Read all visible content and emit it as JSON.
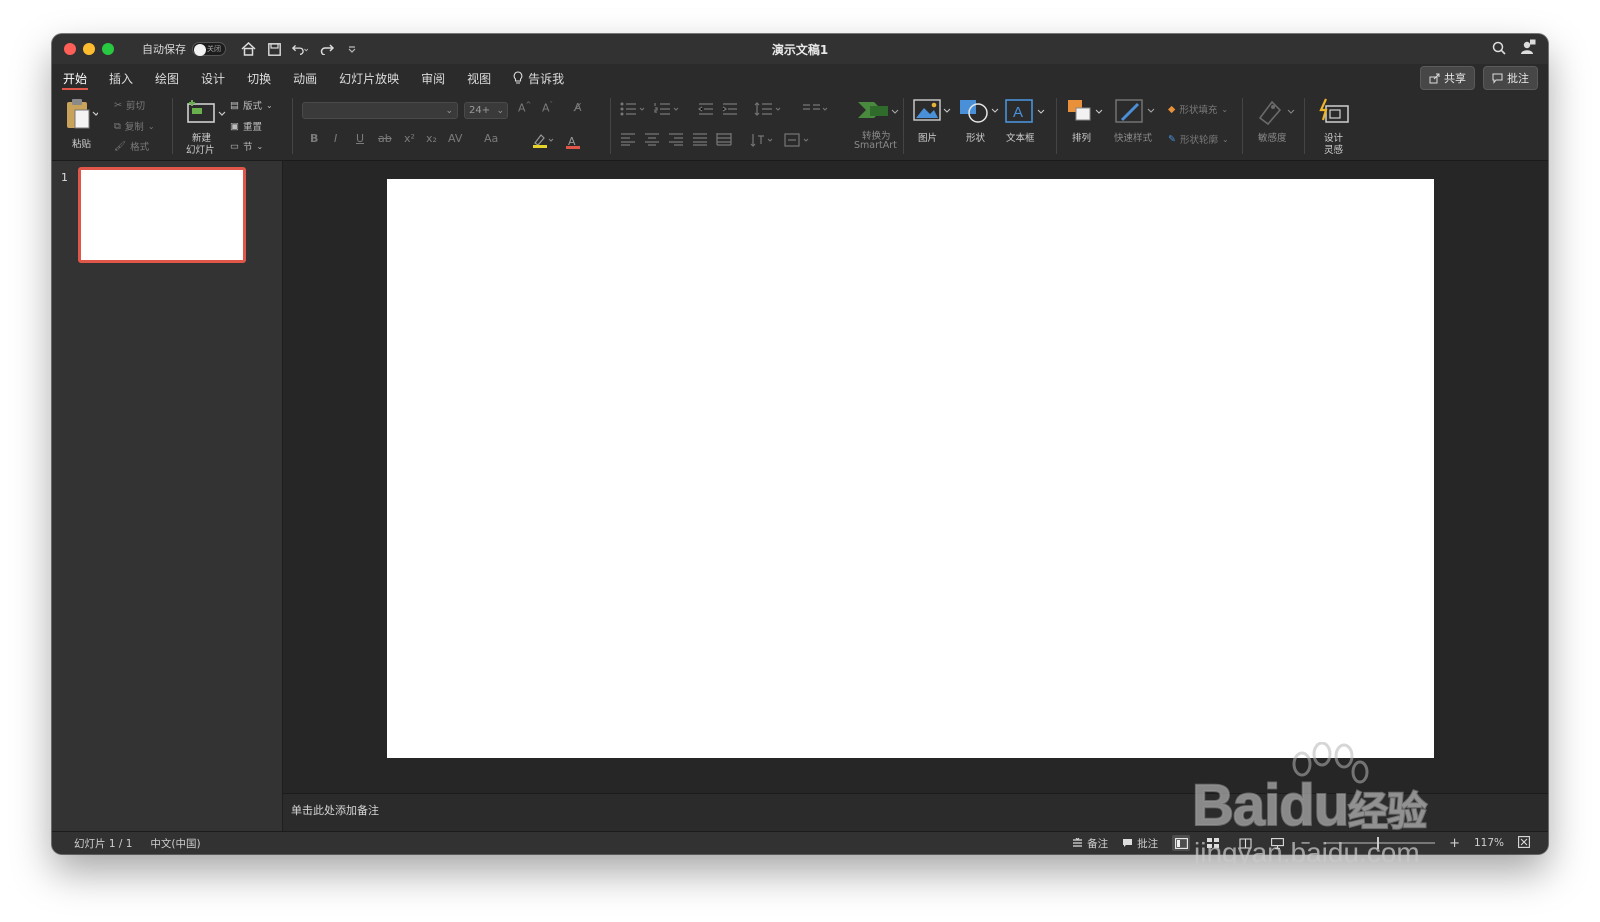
{
  "window": {
    "title": "演示文稿1",
    "autosave_label": "自动保存",
    "autosave_state": "关闭"
  },
  "tabs": [
    {
      "label": "开始",
      "active": true
    },
    {
      "label": "插入"
    },
    {
      "label": "绘图"
    },
    {
      "label": "设计"
    },
    {
      "label": "切换"
    },
    {
      "label": "动画"
    },
    {
      "label": "幻灯片放映"
    },
    {
      "label": "审阅"
    },
    {
      "label": "视图"
    }
  ],
  "tell_me": "告诉我",
  "share_label": "共享",
  "comments_label": "批注",
  "ribbon": {
    "paste": "粘贴",
    "cut": "剪切",
    "copy": "复制",
    "format": "格式",
    "new_slide_1": "新建",
    "new_slide_2": "幻灯片",
    "layout": "版式",
    "reset": "重置",
    "section": "节",
    "font_size": "24+",
    "bold": "B",
    "italic": "I",
    "underline": "U",
    "strike": "ab",
    "superscript": "x²",
    "subscript": "x₂",
    "char_spacing": "AV",
    "change_case": "Aa",
    "font_color": "A",
    "convert_smartart_1": "转换为",
    "convert_smartart_2": "SmartArt",
    "picture": "图片",
    "shape": "形状",
    "textbox": "文本框",
    "arrange": "排列",
    "quick_styles": "快速样式",
    "shape_fill": "形状填充",
    "shape_outline": "形状轮廓",
    "sensitivity": "敏感度",
    "designer_1": "设计",
    "designer_2": "灵感"
  },
  "sidebar": {
    "slide_number": "1"
  },
  "notes_placeholder": "单击此处添加备注",
  "status": {
    "slide_info": "幻灯片 1 / 1",
    "language": "中文(中国)",
    "notes": "备注",
    "comments": "批注",
    "zoom": "117%"
  },
  "watermark": {
    "brand": "Bai",
    "brand_du": "du",
    "brand_cn": "经验",
    "url": "jingyan.baidu.com"
  },
  "colors": {
    "accent": "#e0574a",
    "window_bg": "#2b2b2b",
    "canvas_bg": "#262626",
    "slide_bg": "#ffffff"
  }
}
